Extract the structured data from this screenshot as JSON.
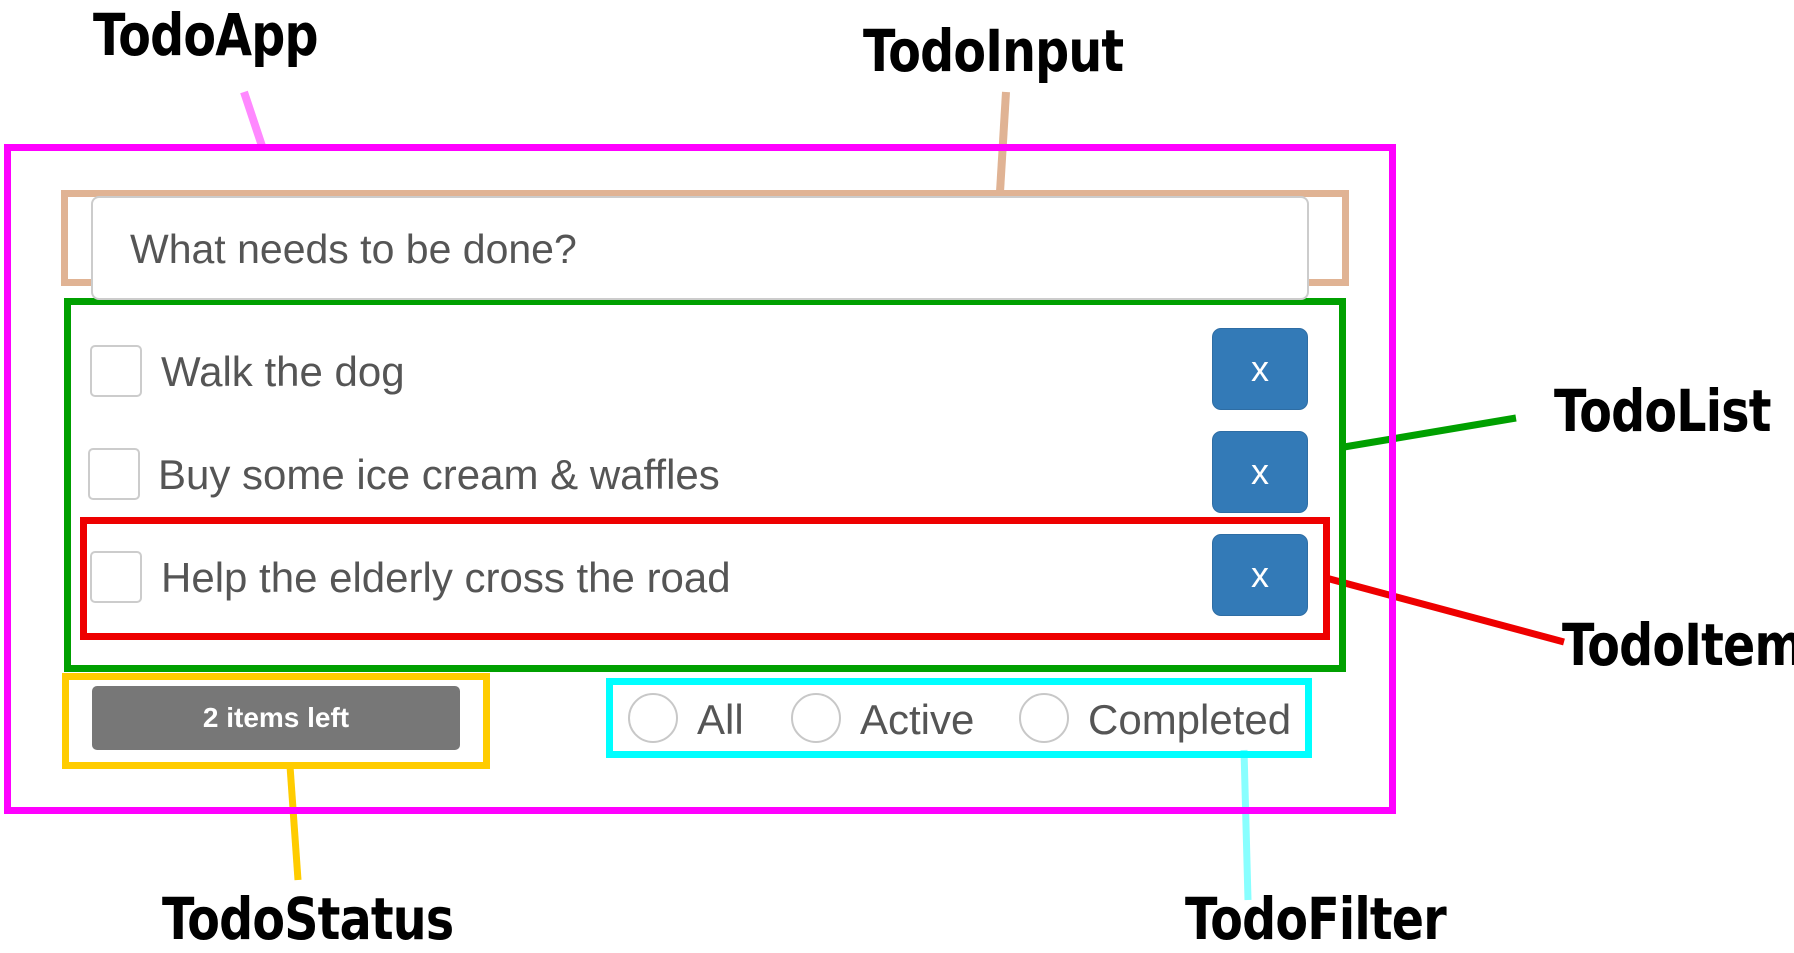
{
  "labels": {
    "todo_app": "TodoApp",
    "todo_input": "TodoInput",
    "todo_list": "TodoList",
    "todo_item": "TodoItem",
    "todo_status": "TodoStatus",
    "todo_filter": "TodoFilter"
  },
  "input": {
    "placeholder": "What needs to be done?"
  },
  "items": [
    {
      "text": "Walk the dog",
      "delete_label": "x"
    },
    {
      "text": "Buy some ice cream & waffles",
      "delete_label": "x"
    },
    {
      "text": "Help the elderly cross the road",
      "delete_label": "x"
    }
  ],
  "status": {
    "text": "2 items left"
  },
  "filters": [
    {
      "label": "All"
    },
    {
      "label": "Active"
    },
    {
      "label": "Completed"
    }
  ],
  "colors": {
    "todo_app": "#ff00ff",
    "todo_input": "#e0b394",
    "todo_list": "#00a000",
    "todo_item": "#ee0000",
    "todo_status": "#ffcc00",
    "todo_filter": "#00ffff",
    "button": "#337ab7",
    "badge": "#777777"
  }
}
